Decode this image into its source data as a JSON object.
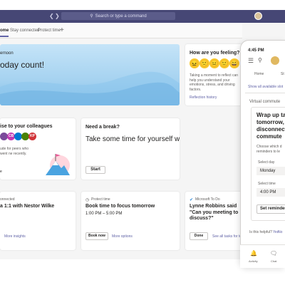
{
  "titlebar": {
    "search_placeholder": "Search or type a command"
  },
  "tabs": [
    {
      "label": "ome"
    },
    {
      "label": "Stay connected"
    },
    {
      "label": "Protect time"
    }
  ],
  "hero": {
    "greeting": "ernoon",
    "title": "oday count!"
  },
  "feelings": {
    "title": "How are you feeling?",
    "emojis": [
      "😖",
      "🙁",
      "😐",
      "🙂",
      "😄"
    ],
    "description": "Taking a moment to reflect can help you understand your emotions, stress, and driving factors.",
    "link": "Reflection history"
  },
  "praise": {
    "title": "ise to your colleagues",
    "avatars": [
      {
        "initials": "",
        "color": "#7a4a9a"
      },
      {
        "initials": "CB",
        "color": "#c239b3"
      },
      {
        "initials": "",
        "color": "#0078d4"
      },
      {
        "initials": "",
        "color": "#498205"
      },
      {
        "initials": "KP",
        "color": "#d13438"
      }
    ],
    "description": "ude for peers who went ne recently.",
    "link": "e"
  },
  "break_card": {
    "title": "Need a break?",
    "text": "Take some time for yourself with a one-minute breathing ex",
    "button": "Start"
  },
  "card1": {
    "label": "onnected",
    "title": "a 1:1 with Nestor Wilke",
    "link": "More insights"
  },
  "card2": {
    "label": "Protect time",
    "title": "Book time to focus tomorrow",
    "date": "1:00 PM – 5:00 PM",
    "button": "Book now",
    "link": "More options"
  },
  "card3": {
    "label": "Microsoft To Do",
    "title": "Lynne Robbins said \"Can you meeting to discuss?\"",
    "button": "Done",
    "link": "See all tasks for to"
  },
  "phone": {
    "time": "4:45 PM",
    "tab_home": "Home",
    "tab_stay": "St",
    "show_all": "Show all available slot",
    "vc_label": "Virtual commute",
    "wrap_title_lines": [
      "Wrap up tas",
      "tomorrow, a",
      "disconnect w",
      "commute"
    ],
    "choose_lines": [
      "Choose which d",
      "reminders to le"
    ],
    "day_label": "Select day",
    "day_value": "Monday",
    "time_label": "Select time",
    "time_value": "4:00 PM",
    "reminder_button": "Set reminder",
    "helpful": "Is this helpful?",
    "yes": "Yes",
    "no": "No",
    "nav_activity": "Activity",
    "nav_chat": "Chat"
  }
}
